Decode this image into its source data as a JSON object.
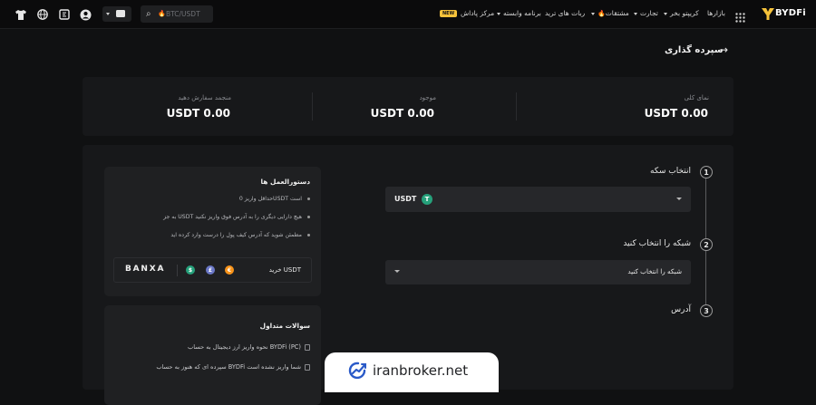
{
  "nav": {
    "brand": "BYDFi",
    "items": [
      {
        "label": "بازارها",
        "caret": false
      },
      {
        "label": "کریپتو بخر",
        "caret": true
      },
      {
        "label": "تجارت",
        "caret": true
      },
      {
        "label": "مشتقات",
        "caret": true
      },
      {
        "label": "ربات های ترید",
        "caret": false
      },
      {
        "label": "برنامه وابسته",
        "caret": true
      },
      {
        "label": "مرکز پاداش",
        "caret": false
      }
    ],
    "new_badge": "NEW",
    "search_placeholder": "BTC/USDT"
  },
  "page": {
    "title": "سپرده گذاری"
  },
  "stats": [
    {
      "label": "نمای کلی",
      "value": "USDT 0.00"
    },
    {
      "label": "موجود",
      "value": "USDT 0.00"
    },
    {
      "label": "منجمد سفارش دهید",
      "value": "USDT 0.00"
    }
  ],
  "steps": [
    {
      "number": "1",
      "title": "انتخاب سکه"
    },
    {
      "number": "2",
      "title": "شبکه را انتخاب کنید"
    },
    {
      "number": "3",
      "title": "آدرس"
    }
  ],
  "coin_select": {
    "value": "USDT",
    "icon_letter": "T"
  },
  "network_select": {
    "value": "شبکه را انتخاب کنید"
  },
  "guide": {
    "title": "دستورالعمل ها",
    "bullets": [
      "حداقل واریز 0USDT است",
      "به جز USDT هیچ دارایی دیگری را به آدرس فوق واریز نکنید",
      "مطمئن شوید که آدرس کیف پول را درست وارد کرده اید"
    ],
    "buy_label": "خرید USDT",
    "partner": "BANXA",
    "coin_symbols": [
      "$",
      "£",
      "€"
    ],
    "colors": {
      "dollar": "#26a17b",
      "pound": "#6b78c7",
      "euro": "#f7931a"
    }
  },
  "faq": {
    "title": "سوالات متداول",
    "items": [
      "نحوه واریز ارز دیجیتال به حساب BYDFi (PC)",
      "سپرده ای که هنوز به حساب BYDFi شما واریز نشده است"
    ]
  },
  "watermark": {
    "text": "iranbroker.net"
  },
  "colors": {
    "accent": "#f6c23a",
    "tether": "#26a17b",
    "background": "#101112",
    "panel": "#17181a"
  }
}
